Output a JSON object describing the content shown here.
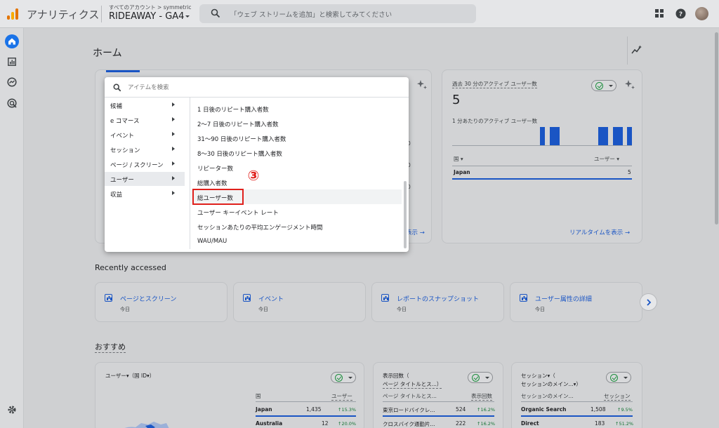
{
  "topbar": {
    "app_name": "アナリティクス",
    "account_path": "すべてのアカウント > symmetric",
    "property_name": "RIDEAWAY - GA4",
    "search_placeholder": "「ウェブ ストリームを追加」と検索してみてください"
  },
  "main": {
    "page_title": "ホーム"
  },
  "realtime_card": {
    "title": "過去 30 分のアクティブ ユーザー数",
    "value": "5",
    "per_minute_label": "1 分あたりのアクティブ ユーザー数",
    "dim_header": "国",
    "metric_header": "ユーザー",
    "row_country": "Japan",
    "row_value": "5",
    "link": "リアルタイムを表示 →"
  },
  "left_card_link": "表示 →",
  "chart_data": {
    "type": "bar",
    "title": "1 分あたりのアクティブ ユーザー数",
    "values": [
      0,
      0,
      0,
      0,
      0,
      0,
      0,
      0,
      0,
      0,
      0,
      0,
      0,
      0,
      0,
      0,
      0,
      0,
      1,
      0,
      1,
      1,
      0,
      0,
      0,
      0,
      0,
      0,
      0,
      0,
      1,
      1,
      0,
      1,
      1,
      0,
      1
    ],
    "xlabel": "",
    "ylabel": ""
  },
  "recently_accessed": {
    "heading": "Recently accessed",
    "items": [
      {
        "label": "ページとスクリーン",
        "date": "今日"
      },
      {
        "label": "イベント",
        "date": "今日"
      },
      {
        "label": "レポートのスナップショット",
        "date": "今日"
      },
      {
        "label": "ユーザー属性の詳細",
        "date": "今日"
      }
    ]
  },
  "recommended": {
    "heading": "おすすめ",
    "card1": {
      "title": "ユーザー▾（国 ID▾）",
      "col_dim": "国",
      "col_metric": "ユーザー",
      "rows": [
        {
          "name": "Japan",
          "value": "1,435",
          "change": "↑15.3%"
        },
        {
          "name": "Australia",
          "value": "12",
          "change": "↑20.0%"
        }
      ]
    },
    "card2": {
      "title_line1": "表示回数（",
      "title_line2": "ページ タイトルとス...）",
      "col_dim": "ページ タイトルとス...",
      "col_metric": "表示回数",
      "rows": [
        {
          "name": "東京ロードバイクレ...",
          "value": "524",
          "change": "↑16.2%"
        },
        {
          "name": "クロスバイク通勤片...",
          "value": "222",
          "change": "↑16.2%"
        }
      ]
    },
    "card3": {
      "title_line1": "セッション▾（",
      "title_line2": "セッションのメイン...▾）",
      "col_dim": "セッションのメイン...",
      "col_metric": "セッション",
      "rows": [
        {
          "name": "Organic Search",
          "value": "1,508",
          "change": "↑9.5%"
        },
        {
          "name": "Direct",
          "value": "183",
          "change": "↑51.2%"
        }
      ]
    }
  },
  "popup": {
    "search_placeholder": "アイテムを検索",
    "categories": [
      "候補",
      "e コマース",
      "イベント",
      "セッション",
      "ページ / スクリーン",
      "ユーザー",
      "収益"
    ],
    "selected_category": "ユーザー",
    "items": [
      "1 日後のリピート購入者数",
      "2〜7 日後のリピート購入者数",
      "31〜90 日後のリピート購入者数",
      "8〜30 日後のリピート購入者数",
      "リピーター数",
      "総購入者数",
      "総ユーザー数",
      "ユーザー キーイベント レート",
      "セッションあたりの平均エンゲージメント時間",
      "WAU/MAU"
    ],
    "highlighted_item": "総ユーザー数"
  },
  "annotation": {
    "step_number": "③",
    "color": "#e0201c"
  },
  "colors": {
    "accent": "#1a73e8",
    "link": "#1a55c4",
    "positive": "#137333"
  }
}
